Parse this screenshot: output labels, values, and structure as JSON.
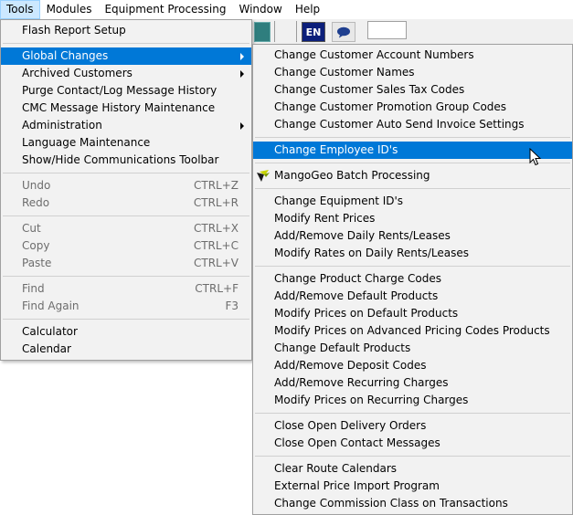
{
  "menubar": {
    "items": [
      "Tools",
      "Modules",
      "Equipment Processing",
      "Window",
      "Help"
    ]
  },
  "toolbar": {
    "language": "EN",
    "icons": [
      "teal-app-icon",
      "chat-bubble-icon"
    ]
  },
  "tools_menu": {
    "groups": [
      [
        {
          "label": "Flash Report Setup",
          "shortcut": "",
          "disabled": false,
          "submenu": false
        }
      ],
      [
        {
          "label": "Global Changes",
          "shortcut": "",
          "disabled": false,
          "submenu": true,
          "highlighted": true
        },
        {
          "label": "Archived Customers",
          "shortcut": "",
          "disabled": false,
          "submenu": true
        },
        {
          "label": "Purge Contact/Log Message History",
          "shortcut": "",
          "disabled": false,
          "submenu": false
        },
        {
          "label": "CMC Message History Maintenance",
          "shortcut": "",
          "disabled": false,
          "submenu": false
        },
        {
          "label": "Administration",
          "shortcut": "",
          "disabled": false,
          "submenu": true
        },
        {
          "label": "Language Maintenance",
          "shortcut": "",
          "disabled": false,
          "submenu": false
        },
        {
          "label": "Show/Hide Communications Toolbar",
          "shortcut": "",
          "disabled": false,
          "submenu": false
        }
      ],
      [
        {
          "label": "Undo",
          "shortcut": "CTRL+Z",
          "disabled": true
        },
        {
          "label": "Redo",
          "shortcut": "CTRL+R",
          "disabled": true
        }
      ],
      [
        {
          "label": "Cut",
          "shortcut": "CTRL+X",
          "disabled": true
        },
        {
          "label": "Copy",
          "shortcut": "CTRL+C",
          "disabled": true
        },
        {
          "label": "Paste",
          "shortcut": "CTRL+V",
          "disabled": true
        }
      ],
      [
        {
          "label": "Find",
          "shortcut": "CTRL+F",
          "disabled": true
        },
        {
          "label": "Find Again",
          "shortcut": "F3",
          "disabled": true
        }
      ],
      [
        {
          "label": "Calculator",
          "shortcut": "",
          "disabled": false
        },
        {
          "label": "Calendar",
          "shortcut": "",
          "disabled": false
        }
      ]
    ]
  },
  "global_changes_menu": {
    "groups": [
      [
        {
          "label": "Change Customer Account Numbers"
        },
        {
          "label": "Change Customer Names"
        },
        {
          "label": "Change Customer Sales Tax Codes"
        },
        {
          "label": "Change Customer Promotion Group Codes"
        },
        {
          "label": "Change Customer Auto Send Invoice Settings"
        }
      ],
      [
        {
          "label": "Change Employee ID's",
          "highlighted": true
        }
      ],
      [
        {
          "label": "MangoGeo Batch Processing",
          "icon": "mangogeo-icon"
        }
      ],
      [
        {
          "label": "Change Equipment ID's"
        },
        {
          "label": "Modify Rent Prices"
        },
        {
          "label": "Add/Remove Daily Rents/Leases"
        },
        {
          "label": "Modify Rates on Daily Rents/Leases"
        }
      ],
      [
        {
          "label": "Change Product Charge Codes"
        },
        {
          "label": "Add/Remove Default Products"
        },
        {
          "label": "Modify Prices on Default Products"
        },
        {
          "label": "Modify Prices on Advanced Pricing Codes Products"
        },
        {
          "label": "Change Default Products"
        },
        {
          "label": "Add/Remove Deposit Codes"
        },
        {
          "label": "Add/Remove Recurring Charges"
        },
        {
          "label": "Modify Prices on Recurring Charges"
        }
      ],
      [
        {
          "label": "Close Open Delivery Orders"
        },
        {
          "label": "Close Open Contact Messages"
        }
      ],
      [
        {
          "label": "Clear Route Calendars"
        },
        {
          "label": "External Price Import Program"
        },
        {
          "label": "Change Commission Class on Transactions"
        }
      ]
    ]
  },
  "colors": {
    "highlight": "#0078d7",
    "menu_bg": "#f2f2f2",
    "menubar_active": "#cce8ff"
  }
}
